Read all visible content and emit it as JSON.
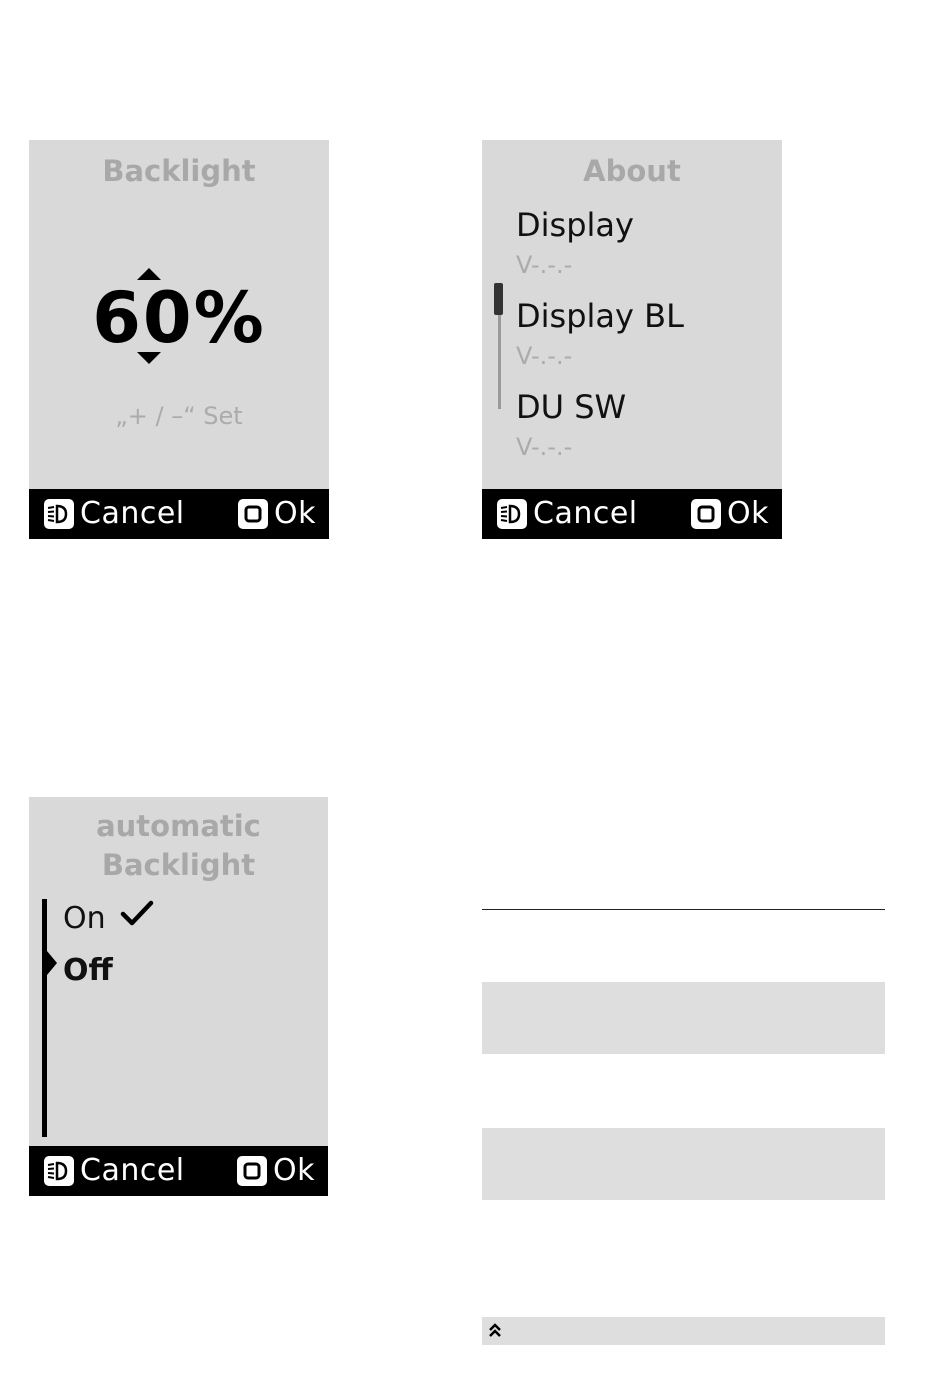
{
  "backlight_screen": {
    "title": "Backlight",
    "value": "60%",
    "value_percent": 60,
    "hint": "„+ / –“ Set",
    "footer": {
      "cancel_label": "Cancel",
      "ok_label": "Ok",
      "cancel_icon": "light-key-icon",
      "ok_icon": "ok-key-icon"
    }
  },
  "about_screen": {
    "title": "About",
    "items": [
      {
        "name": "Display",
        "version": "V-.-.-"
      },
      {
        "name": "Display BL",
        "version": "V-.-.-"
      },
      {
        "name": "DU SW",
        "version": "V-.-.-"
      }
    ],
    "footer": {
      "cancel_label": "Cancel",
      "ok_label": "Ok",
      "cancel_icon": "light-key-icon",
      "ok_icon": "ok-key-icon"
    }
  },
  "auto_backlight_screen": {
    "title_line1": "automatic",
    "title_line2": "Backlight",
    "options": [
      {
        "label": "On",
        "checked": true
      },
      {
        "label": "Off",
        "checked": false,
        "selected": true
      }
    ],
    "footer": {
      "cancel_label": "Cancel",
      "ok_label": "Ok",
      "cancel_icon": "light-key-icon",
      "ok_icon": "ok-key-icon"
    }
  },
  "colors": {
    "screen_bg": "#d9d9d9",
    "footer_bg": "#000000",
    "title_gray": "#a8a8a8",
    "placeholder_box": "#dedede"
  },
  "icons": {
    "bottom_box": "double-chevron-up-icon"
  }
}
